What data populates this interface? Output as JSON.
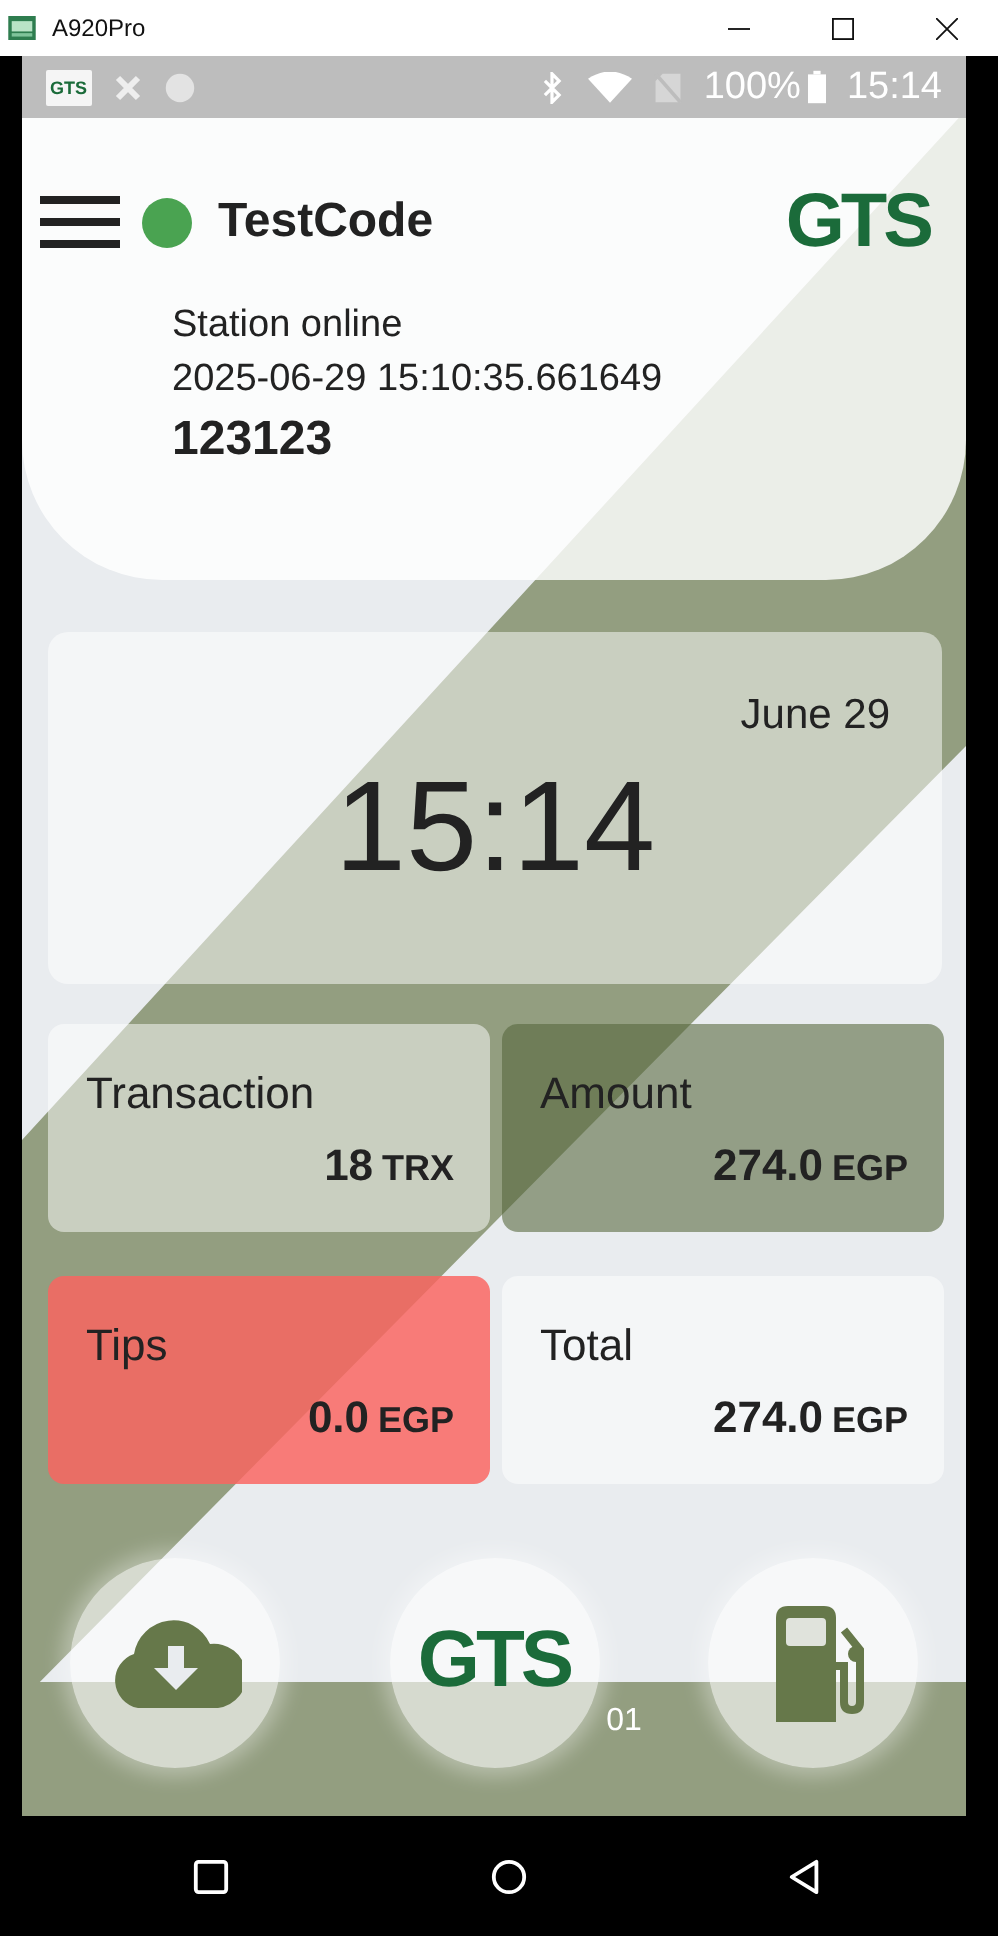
{
  "window": {
    "title": "A920Pro"
  },
  "status_bar": {
    "app_badge": "GTS",
    "battery": "100%",
    "time": "15:14"
  },
  "header": {
    "station_name": "TestCode",
    "online": true,
    "logo": "GTS",
    "status": "Station online",
    "timestamp": "2025-06-29 15:10:35.661649",
    "code": "123123"
  },
  "clock": {
    "date": "June 29",
    "time": "15:14"
  },
  "stats": [
    {
      "kind": "plain",
      "label": "Transaction",
      "value": "18",
      "unit": "TRX"
    },
    {
      "kind": "highlight",
      "label": "Amount",
      "value": "274.0",
      "unit": "EGP"
    },
    {
      "kind": "alert",
      "label": "Tips",
      "value": "0.0",
      "unit": "EGP"
    },
    {
      "kind": "plain",
      "label": "Total",
      "value": "274.0",
      "unit": "EGP"
    }
  ],
  "bottom_actions": [
    {
      "kind": "download"
    },
    {
      "kind": "logo",
      "logo": "GTS",
      "caption": "01"
    },
    {
      "kind": "fuel"
    }
  ]
}
